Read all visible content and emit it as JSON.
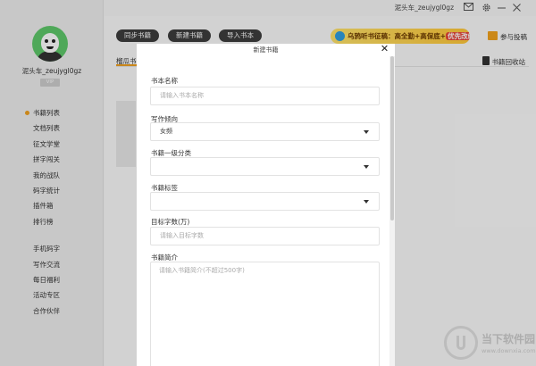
{
  "topbar": {
    "username": "泥头车_zeujygl0gz",
    "mail_icon": "mail-icon",
    "gear_icon": "gear-icon",
    "minimize_icon": "minimize-icon",
    "close_icon": "close-icon"
  },
  "sidebar": {
    "username": "泥头车_zeujygl0gz",
    "vip_label": "VIP",
    "items_top": [
      {
        "label": "书籍列表",
        "active": true
      },
      {
        "label": "文档列表"
      },
      {
        "label": "征文学堂"
      },
      {
        "label": "拼字闯关"
      },
      {
        "label": "我的战队"
      },
      {
        "label": "码字统计"
      },
      {
        "label": "插件箱"
      },
      {
        "label": "排行榜"
      }
    ],
    "items_bottom": [
      {
        "label": "手机码字"
      },
      {
        "label": "写作交流"
      },
      {
        "label": "每日福利"
      },
      {
        "label": "活动专区"
      },
      {
        "label": "合作伙伴"
      }
    ]
  },
  "main": {
    "buttons": {
      "sync": "同步书籍",
      "new": "新建书籍",
      "import": "导入书本"
    },
    "banner": {
      "part1": "乌鸦听书征稿：高全勤+高保底+",
      "highlight": "优先改编有声"
    },
    "contribute_label": "参与投稿",
    "tab_label": "榴瓜书",
    "recycle_label": "书籍回收站"
  },
  "modal": {
    "title": "新建书籍",
    "fields": {
      "book_name": {
        "label": "书本名称",
        "placeholder": "请输入书本名称"
      },
      "writing_tendency": {
        "label": "写作倾向",
        "value": "女频"
      },
      "category": {
        "label": "书籍一级分类",
        "value": ""
      },
      "tags": {
        "label": "书籍标签",
        "value": ""
      },
      "target_words": {
        "label": "目标字数(万)",
        "placeholder": "请输入目标字数"
      },
      "intro": {
        "label": "书籍简介",
        "placeholder": "请输入书籍简介(不超过500字)"
      }
    }
  },
  "watermark": {
    "text": "当下软件园",
    "url": "www.downxia.com"
  }
}
